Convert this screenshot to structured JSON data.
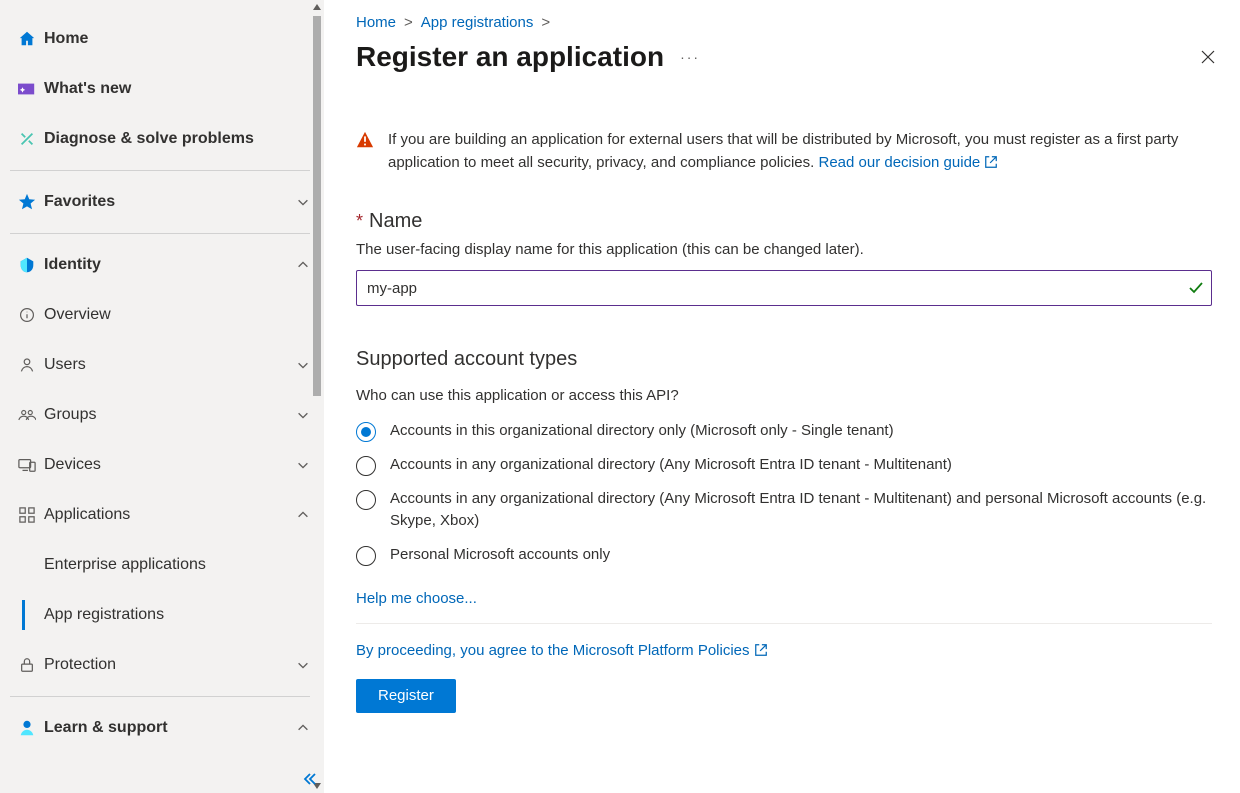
{
  "sidebar": {
    "home": "Home",
    "whatsnew": "What's new",
    "diagnose": "Diagnose & solve problems",
    "favorites": "Favorites",
    "identity": "Identity",
    "overview": "Overview",
    "users": "Users",
    "groups": "Groups",
    "devices": "Devices",
    "applications": "Applications",
    "enterprise_apps": "Enterprise applications",
    "app_registrations": "App registrations",
    "protection": "Protection",
    "learn_support": "Learn & support"
  },
  "breadcrumbs": {
    "home": "Home",
    "appreg": "App registrations"
  },
  "page": {
    "title": "Register an application"
  },
  "warning": {
    "text_before": "If you are building an application for external users that will be distributed by Microsoft, you must register as a first party application to meet all security, privacy, and compliance policies. ",
    "link": "Read our decision guide"
  },
  "name_field": {
    "label": "Name",
    "help": "The user-facing display name for this application (this can be changed later).",
    "value": "my-app"
  },
  "account_types": {
    "heading": "Supported account types",
    "sub": "Who can use this application or access this API?",
    "options": [
      "Accounts in this organizational directory only (Microsoft only - Single tenant)",
      "Accounts in any organizational directory (Any Microsoft Entra ID tenant - Multitenant)",
      "Accounts in any organizational directory (Any Microsoft Entra ID tenant - Multitenant) and personal Microsoft accounts (e.g. Skype, Xbox)",
      "Personal Microsoft accounts only"
    ],
    "help_link": "Help me choose..."
  },
  "footer": {
    "policy": "By proceeding, you agree to the Microsoft Platform Policies",
    "register": "Register"
  }
}
